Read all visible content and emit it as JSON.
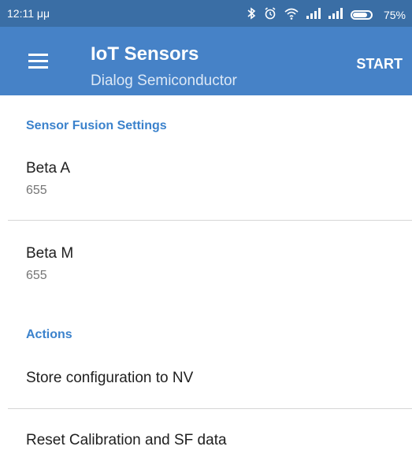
{
  "status_bar": {
    "time": "12:11 μμ",
    "battery": "75%",
    "icons": [
      "bluetooth-icon",
      "alarm-icon",
      "wifi-icon",
      "signal-icon",
      "signal-icon",
      "battery-icon"
    ]
  },
  "app_bar": {
    "title": "IoT Sensors",
    "subtitle": "Dialog Semiconductor",
    "action": "START",
    "menu_icon": "hamburger-menu-icon"
  },
  "sections": {
    "sensor_fusion": {
      "header": "Sensor Fusion Settings",
      "beta_a": {
        "title": "Beta A",
        "value": "655"
      },
      "beta_m": {
        "title": "Beta M",
        "value": "655"
      }
    },
    "actions": {
      "header": "Actions",
      "store": "Store configuration to NV",
      "reset": "Reset Calibration and SF data"
    }
  },
  "colors": {
    "status_bar": "#3a6ea5",
    "app_bar": "#4682c7",
    "accent": "#3b82cc"
  }
}
